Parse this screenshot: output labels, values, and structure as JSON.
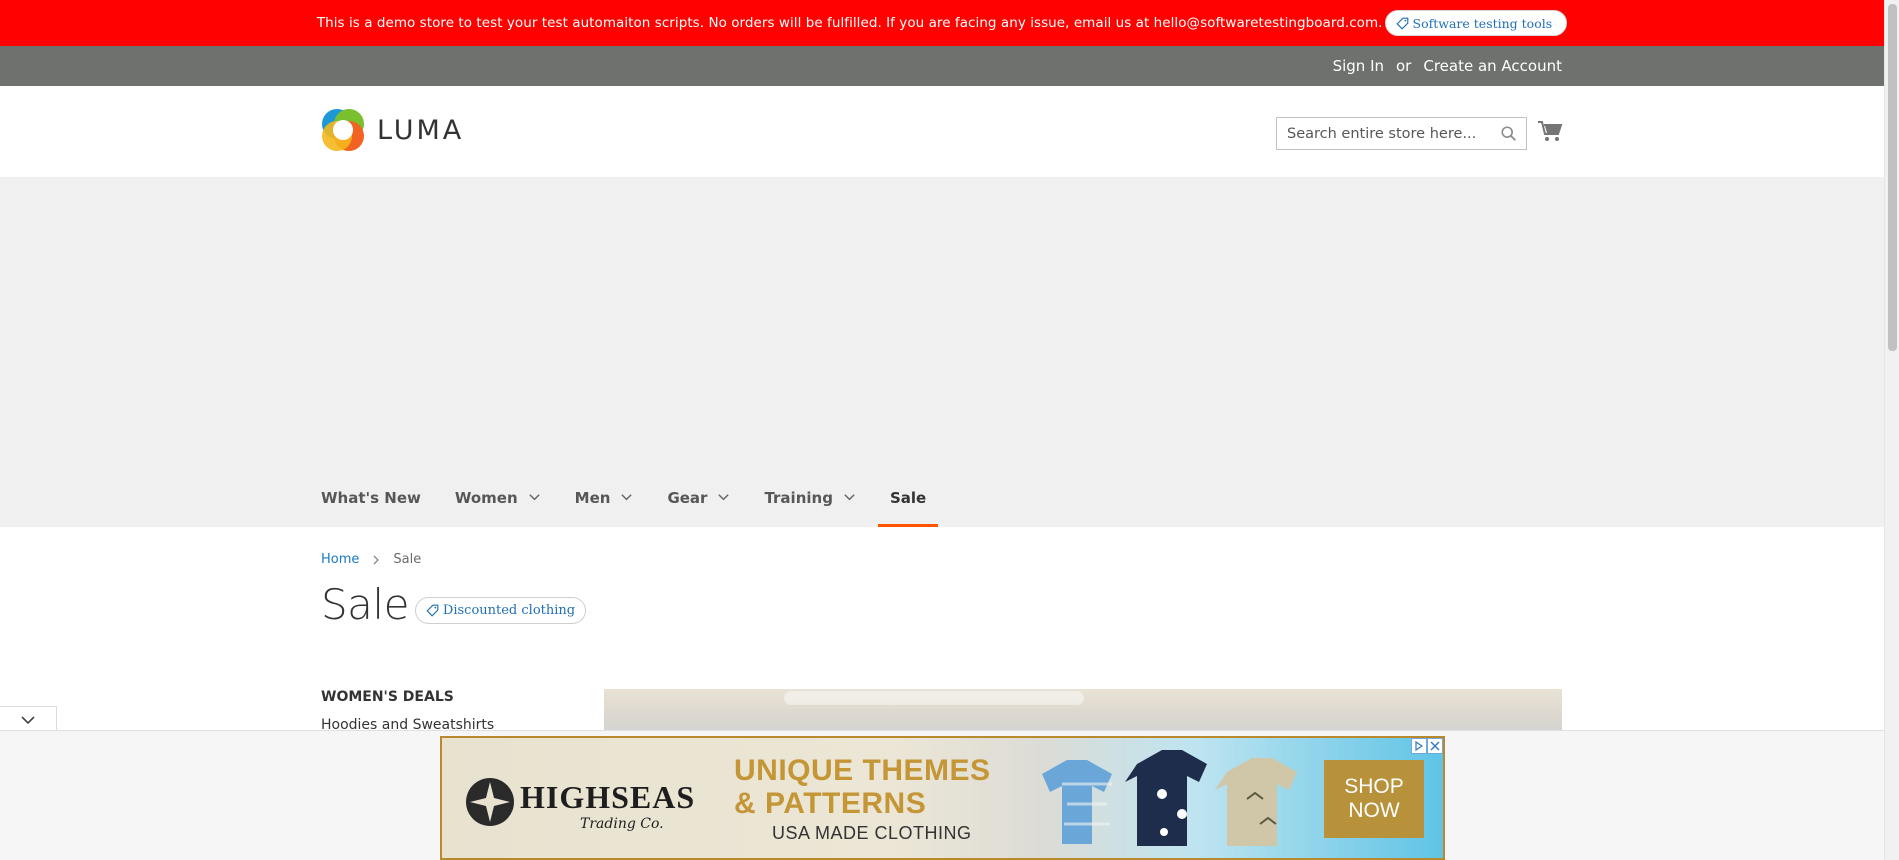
{
  "notice_bar": {
    "text": "This is a demo store to test your test automaiton scripts. No orders will be fulfilled. If you are facing any issue, email us at hello@softwaretestingboard.com.",
    "pill_label": "Software testing tools",
    "background": "#ff0101"
  },
  "account": {
    "sign_in": "Sign In",
    "or": "or",
    "create_account": "Create an Account"
  },
  "header": {
    "logo_text": "LUMA",
    "search_placeholder": "Search entire store here..."
  },
  "nav": {
    "items": [
      {
        "label": "What's New"
      },
      {
        "label": "Women"
      },
      {
        "label": "Men"
      },
      {
        "label": "Gear"
      },
      {
        "label": "Training"
      },
      {
        "label": "Sale"
      }
    ],
    "accent": "#ff5501"
  },
  "breadcrumb": {
    "home": "Home",
    "current": "Sale"
  },
  "page": {
    "title": "Sale",
    "title_pill": "Discounted clothing"
  },
  "sidebar": {
    "heading": "WOMEN'S DEALS",
    "first_link": "Hoodies and Sweatshirts"
  },
  "ad": {
    "brand": "HIGHSEAS",
    "brand_sub": "Trading Co.",
    "headline_line1": "UNIQUE THEMES",
    "headline_line2": "& PATTERNS",
    "subline": "USA MADE CLOTHING",
    "cta_line1": "SHOP",
    "cta_line2": "NOW"
  }
}
